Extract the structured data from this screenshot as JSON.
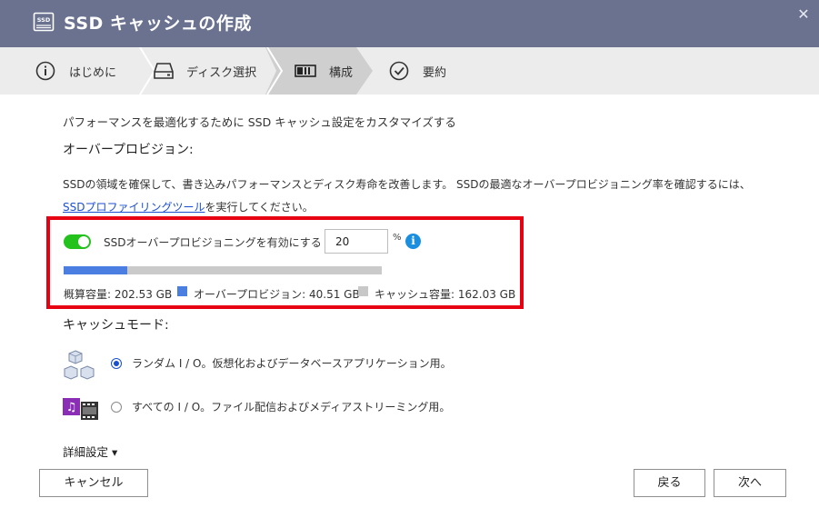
{
  "window": {
    "title": "SSD キャッシュの作成",
    "title_icon": "ssd-icon",
    "close_icon": "close-icon"
  },
  "steps": [
    {
      "label": "はじめに",
      "icon": "info-circle-icon",
      "active": false
    },
    {
      "label": "ディスク選択",
      "icon": "disk-icon",
      "active": false
    },
    {
      "label": "構成",
      "icon": "config-icon",
      "active": true
    },
    {
      "label": "要約",
      "icon": "check-circle-icon",
      "active": false
    }
  ],
  "content": {
    "intro": "パフォーマンスを最適化するために SSD キャッシュ設定をカスタマイズする",
    "over_provisioning_heading": "オーバープロビジョン:",
    "desc_line1": "SSDの領域を確保して、書き込みパフォーマンスとディスク寿命を改善します。 SSDの最適なオーバープロビジョニング率を確認するには、",
    "profiling_link": "SSDプロファイリングツール",
    "desc_line2_suffix": "を実行してください。",
    "op_toggle_label": "SSDオーバープロビジョニングを有効にする",
    "op_enabled": true,
    "op_percent_value": "20",
    "op_percent_unit": "%",
    "info_icon_glyph": "i",
    "capacity_bar_fraction": 0.2,
    "capacity": {
      "total": "概算容量: 202.53 GB",
      "over_provision": "オーバープロビジョン: 40.51 GB",
      "cache": "キャッシュ容量: 162.03 GB"
    },
    "cache_mode_heading": "キャッシュモード:",
    "cache_modes": [
      {
        "label": "ランダム I / O。仮想化およびデータベースアプリケーション用。",
        "icon": "cubes-icon",
        "selected": true
      },
      {
        "label": "すべての I / O。ファイル配信およびメディアストリーミング用。",
        "icon": "media-icon",
        "selected": false
      }
    ],
    "advanced_settings": "詳細設定 ▾"
  },
  "footer": {
    "cancel": "キャンセル",
    "back": "戻る",
    "next": "次へ"
  },
  "colors": {
    "titlebar": "#6b7290",
    "steps_bg": "#ececec",
    "step_active": "#cfcfcf",
    "highlight_border": "#e60012",
    "toggle_on": "#23c21c",
    "bar_fill": "#4a7ee0",
    "bar_track": "#cacaca",
    "link": "#1b4fd2"
  }
}
